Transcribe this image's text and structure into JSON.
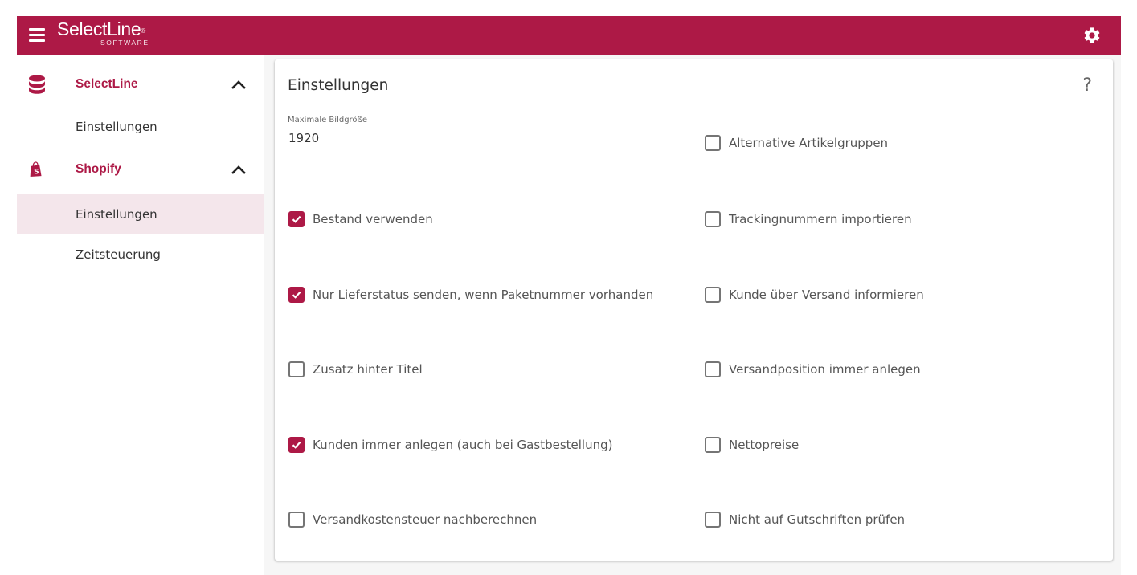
{
  "app": {
    "brand": "SelectLine",
    "brand_reg": "®",
    "brand_sub": "SOFTWARE"
  },
  "colors": {
    "accent": "#ad1946",
    "active_bg": "#f4e6eb"
  },
  "icons": {
    "menu": "hamburger-icon",
    "settings": "gear-icon",
    "selectline_group": "database-icon",
    "shopify_group": "shopping-bag-icon",
    "collapse": "chevron-up-icon",
    "help": "question-mark-icon"
  },
  "sidebar": {
    "groups": [
      {
        "label": "SelectLine",
        "expanded": true,
        "items": [
          {
            "label": "Einstellungen",
            "active": false
          }
        ]
      },
      {
        "label": "Shopify",
        "expanded": true,
        "items": [
          {
            "label": "Einstellungen",
            "active": true
          },
          {
            "label": "Zeitsteuerung",
            "active": false
          }
        ]
      }
    ]
  },
  "main": {
    "title": "Einstellungen",
    "help": "?",
    "image_size": {
      "label": "Maximale Bildgröße",
      "value": "1920"
    },
    "left_options": [
      {
        "label": "Bestand verwenden",
        "checked": true
      },
      {
        "label": "Nur Lieferstatus senden, wenn Paketnummer vorhanden",
        "checked": true
      },
      {
        "label": "Zusatz hinter Titel",
        "checked": false
      },
      {
        "label": "Kunden immer anlegen (auch bei Gastbestellung)",
        "checked": true
      },
      {
        "label": "Versandkostensteuer nachberechnen",
        "checked": false
      }
    ],
    "right_options": [
      {
        "label": "Alternative Artikelgruppen",
        "checked": false
      },
      {
        "label": "Trackingnummern importieren",
        "checked": false
      },
      {
        "label": "Kunde über Versand informieren",
        "checked": false
      },
      {
        "label": "Versandposition immer anlegen",
        "checked": false
      },
      {
        "label": "Nettopreise",
        "checked": false
      },
      {
        "label": "Nicht auf Gutschriften prüfen",
        "checked": false
      }
    ]
  }
}
